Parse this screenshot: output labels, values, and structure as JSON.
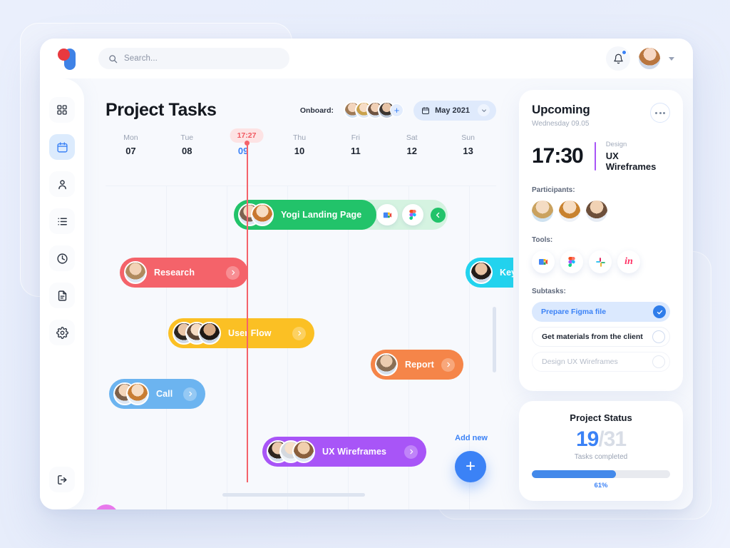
{
  "brand": {
    "logo_name": "logo-mark"
  },
  "topbar": {
    "search_placeholder": "Search...",
    "search_icon": "search-icon",
    "bell_icon": "bell-icon",
    "avatar_chevron_icon": "chevron-down-icon"
  },
  "sidebar": {
    "items": [
      {
        "icon": "grid-icon",
        "name": "dashboard"
      },
      {
        "icon": "calendar-icon",
        "name": "calendar"
      },
      {
        "icon": "person-icon",
        "name": "contacts"
      },
      {
        "icon": "list-icon",
        "name": "tasks"
      },
      {
        "icon": "clock-icon",
        "name": "time"
      },
      {
        "icon": "document-icon",
        "name": "documents"
      },
      {
        "icon": "gear-icon",
        "name": "settings"
      }
    ],
    "logout": {
      "icon": "logout-icon",
      "name": "logout"
    },
    "active_index": 1
  },
  "main": {
    "title": "Project Tasks",
    "onboard_label": "Onboard:",
    "onboard_avatars": 4,
    "add_user_label": "+",
    "date_selector": {
      "value": "May 2021",
      "icon": "calendar-icon",
      "chevron": "chevron-down-icon"
    },
    "now_marker": "17:27",
    "days": [
      {
        "name": "Mon",
        "num": "07",
        "today": false
      },
      {
        "name": "Tue",
        "num": "08",
        "today": false
      },
      {
        "name": "Wed",
        "num": "09",
        "today": true
      },
      {
        "name": "Thu",
        "num": "10",
        "today": false
      },
      {
        "name": "Fri",
        "num": "11",
        "today": false
      },
      {
        "name": "Sat",
        "num": "12",
        "today": false
      },
      {
        "name": "Sun",
        "num": "13",
        "today": false
      }
    ],
    "tasks": [
      {
        "label": "Yogi Landing Page",
        "color": "#22c36a",
        "arrow": "chevron-left-icon"
      },
      {
        "label": "Research",
        "color": "#f4636a",
        "arrow": "chevron-right-icon"
      },
      {
        "label": "Key Visuals",
        "color": "#22d3ee",
        "arrow": "chevron-right-icon"
      },
      {
        "label": "User Flow",
        "color": "#fbc024",
        "arrow": "chevron-right-icon"
      },
      {
        "label": "Report",
        "color": "#f58549",
        "arrow": "chevron-right-icon"
      },
      {
        "label": "Call",
        "color": "#6cb4f0",
        "arrow": "chevron-right-icon"
      },
      {
        "label": "UX Wireframes",
        "color": "#a855f7",
        "arrow": "chevron-right-icon"
      }
    ],
    "task_tools": [
      "google-meet-icon",
      "figma-icon"
    ],
    "add_new_label": "Add new",
    "add_new_button": "+"
  },
  "panel": {
    "upcoming": {
      "title": "Upcoming",
      "subtitle": "Wednesday 09.05",
      "more_icon": "more-options-icon",
      "time": "17:30",
      "category": "Design",
      "event": "UX Wireframes",
      "accent": "#a855f7",
      "participants_label": "Participants:",
      "participants_count": 3,
      "tools_label": "Tools:",
      "tools": [
        "google-meet-icon",
        "figma-icon",
        "slack-icon",
        "invision-icon"
      ],
      "subtasks_label": "Subtasks:",
      "subtasks": [
        {
          "text": "Prepare Figma file",
          "state": "done"
        },
        {
          "text": "Get materials from the client",
          "state": "open"
        },
        {
          "text": "Design UX Wireframes",
          "state": "muted"
        }
      ]
    },
    "status": {
      "title": "Project Status",
      "completed": "19",
      "separator": "/",
      "total": "31",
      "caption": "Tasks completed",
      "percent_label": "61%",
      "percent_value": 61,
      "bar_color": "#4389ea"
    }
  }
}
